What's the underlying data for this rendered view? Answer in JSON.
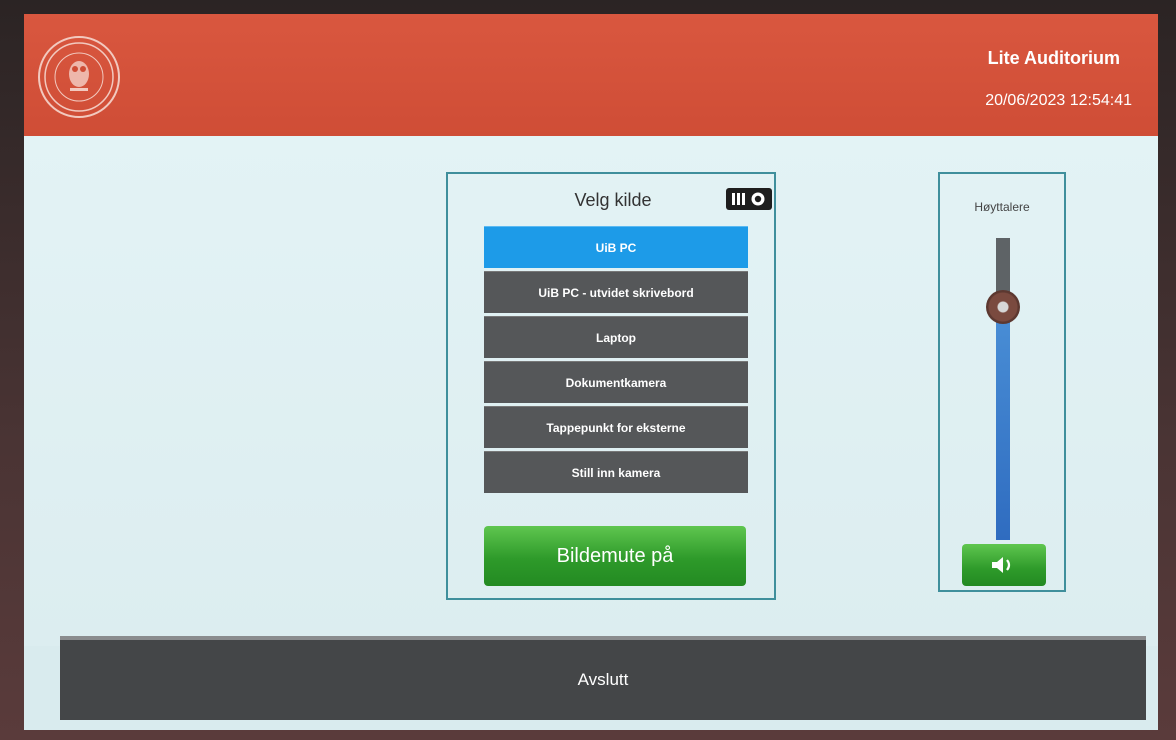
{
  "header": {
    "room_name": "Lite Auditorium",
    "datetime": "20/06/2023 12:54:41",
    "logo_icon": "university-seal-icon"
  },
  "source_panel": {
    "title": "Velg kilde",
    "status_icon": "projector-icon",
    "sources": [
      {
        "label": "UiB PC",
        "active": true
      },
      {
        "label": "UiB PC - utvidet skrivebord",
        "active": false
      },
      {
        "label": "Laptop",
        "active": false
      },
      {
        "label": "Dokumentkamera",
        "active": false
      },
      {
        "label": "Tappepunkt for eksterne",
        "active": false
      },
      {
        "label": "Still inn kamera",
        "active": false
      }
    ],
    "mute_label": "Bildemute på"
  },
  "volume_panel": {
    "title": "Høyttalere",
    "level": 0.77,
    "speaker_icon": "speaker-icon"
  },
  "footer": {
    "exit_label": "Avslutt"
  },
  "colors": {
    "header": "#d9573f",
    "active_source": "#1d9be8",
    "source_button": "#555759",
    "green_button": "#2e9a2a",
    "panel_border": "#3f8f9c"
  }
}
